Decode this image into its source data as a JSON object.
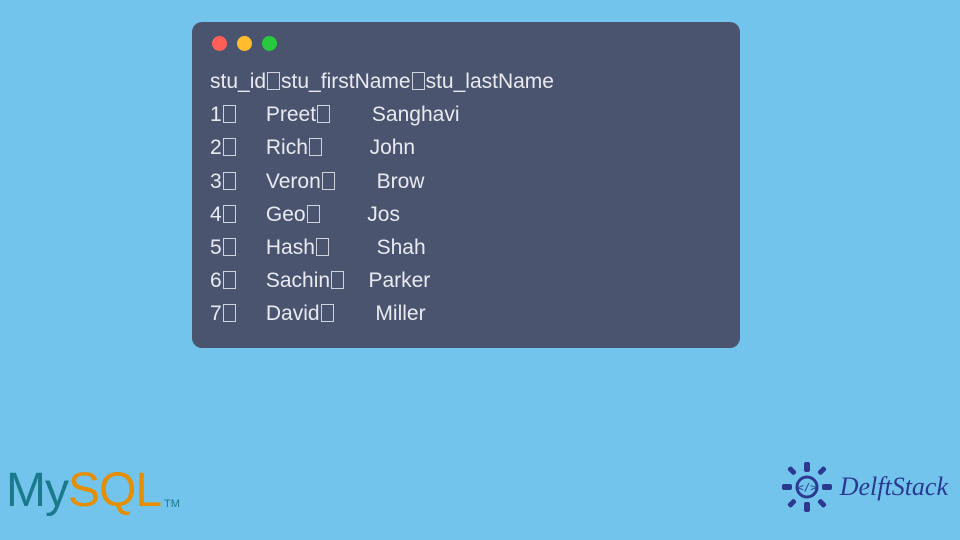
{
  "terminal": {
    "header": {
      "col1": "stu_id",
      "col2": "stu_firstName",
      "col3": "stu_lastName"
    },
    "rows": [
      {
        "id": "1",
        "first": "Preet",
        "last": "Sanghavi"
      },
      {
        "id": "2",
        "first": "Rich",
        "last": "John"
      },
      {
        "id": "3",
        "first": "Veron",
        "last": "Brow"
      },
      {
        "id": "4",
        "first": "Geo",
        "last": "Jos"
      },
      {
        "id": "5",
        "first": "Hash",
        "last": "Shah"
      },
      {
        "id": "6",
        "first": "Sachin",
        "last": "Parker"
      },
      {
        "id": "7",
        "first": "David",
        "last": "Miller"
      }
    ]
  },
  "logo": {
    "my": "My",
    "sql": "SQL",
    "tm": "TM"
  },
  "brand": {
    "name": "DelftStack"
  }
}
